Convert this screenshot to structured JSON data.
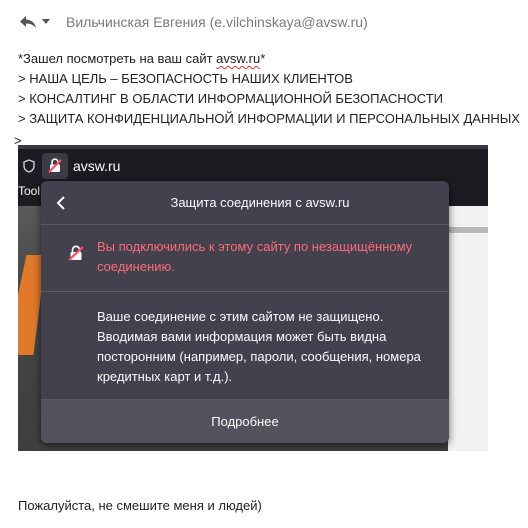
{
  "header": {
    "sender": "Вильчинская Евгения (e.vilchinskaya@avsw.ru)"
  },
  "body": {
    "line1_prefix": "*Зашел посмотреть на ваш сайт ",
    "line1_link": "avsw.ru",
    "line1_suffix": "*",
    "line2": "> НАША ЦЕЛЬ – БЕЗОПАСНОСТЬ НАШИХ КЛИЕНТОВ",
    "line3": "> КОНСАЛТИНГ В ОБЛАСТИ ИНФОРМАЦИОННОЙ БЕЗОПАСНОСТИ",
    "line4": "> ЗАЩИТА КОНФИДЕНЦИАЛЬНОЙ ИНФОРМАЦИИ И ПЕРСОНАЛЬНЫХ ДАННЫХ",
    "line5": ">"
  },
  "screenshot": {
    "url": "avsw.ru",
    "toolbar_text": "Tool",
    "panel_title": "Защита соединения с avsw.ru",
    "warning": "Вы подключились к этому сайту по незащищённому соединению.",
    "info": "Ваше соединение с этим сайтом не защищено. Вводимая вами информация может быть видна посторонним (например, пароли, сообщения, номера кредитных карт и т.д.).",
    "more_button": "Подробнее",
    "colors": {
      "panel_bg": "#42414d",
      "warning_text": "#ff6b78",
      "urlbar_bg": "#1c1b22"
    }
  },
  "footer": {
    "text": "Пожалуйста, не смешите меня и людей)"
  },
  "icons": [
    "reply-icon",
    "chevron-down-icon",
    "shield-icon",
    "insecure-lock-icon",
    "back-chevron-icon",
    "insecure-lock-warning-icon"
  ]
}
